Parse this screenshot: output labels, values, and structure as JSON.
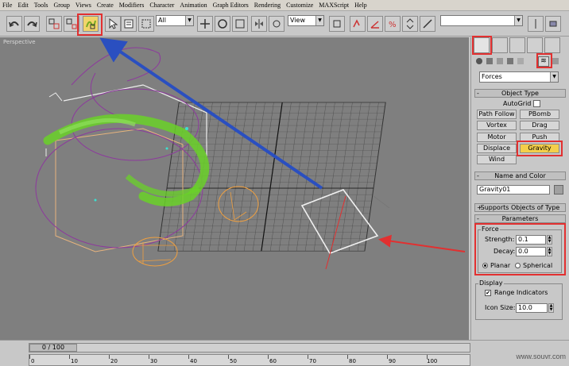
{
  "menu": [
    "File",
    "Edit",
    "Tools",
    "Group",
    "Views",
    "Create",
    "Modifiers",
    "Character",
    "Animation",
    "Graph Editors",
    "Rendering",
    "Customize",
    "MAXScript",
    "Help"
  ],
  "toolbar": {
    "selection_filter": "All",
    "ref_coord": "View"
  },
  "viewport": {
    "label": "Perspective"
  },
  "panel": {
    "category": "Forces",
    "object_type_header": "Object Type",
    "autogrid_label": "AutoGrid",
    "buttons": [
      "Path Follow",
      "PBomb",
      "Vortex",
      "Drag",
      "Motor",
      "Push",
      "Displace",
      "Gravity",
      "Wind"
    ],
    "active_button": "Gravity",
    "name_color_header": "Name and Color",
    "object_name": "Gravity01",
    "supports_header": "Supports Objects of Type",
    "parameters_header": "Parameters",
    "force_group": "Force",
    "strength_label": "Strength:",
    "strength_value": "0.1",
    "decay_label": "Decay:",
    "decay_value": "0.0",
    "planar_label": "Planar",
    "spherical_label": "Spherical",
    "display_group": "Display",
    "range_label": "Range Indicators",
    "iconsize_label": "Icon Size:",
    "iconsize_value": "10.0"
  },
  "timeline": {
    "slider": "0 / 100",
    "ticks": [
      "0",
      "10",
      "20",
      "30",
      "40",
      "50",
      "60",
      "70",
      "80",
      "90",
      "100"
    ]
  },
  "watermark": "www.souvr.com",
  "colors": {
    "highlight": "#e23030",
    "arrow_blue": "#2a4fc0",
    "gravity_active": "#f4cf4a",
    "particles": "#6ad128"
  }
}
